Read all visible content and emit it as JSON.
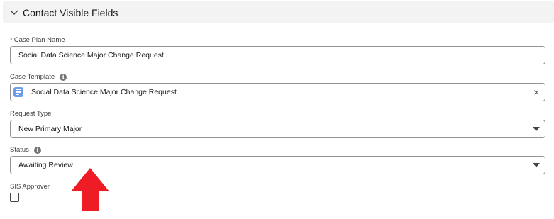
{
  "section": {
    "title": "Contact Visible Fields",
    "icon": "chevron-down-icon"
  },
  "fields": {
    "case_plan_name": {
      "required_marker": "*",
      "label": "Case Plan Name",
      "value": "Social Data Science Major Change Request"
    },
    "case_template": {
      "label": "Case Template",
      "info_icon": "info-icon",
      "record_icon": "template-record-icon",
      "value": "Social Data Science Major Change Request",
      "clear": "×"
    },
    "request_type": {
      "label": "Request Type",
      "value": "New Primary Major"
    },
    "status": {
      "label": "Status",
      "info_icon": "info-icon",
      "value": "Awaiting Review"
    },
    "sis_approver": {
      "label": "SIS Approver",
      "checked": false
    }
  },
  "annotation": {
    "type": "red-up-arrow",
    "color": "#ee1c25"
  }
}
